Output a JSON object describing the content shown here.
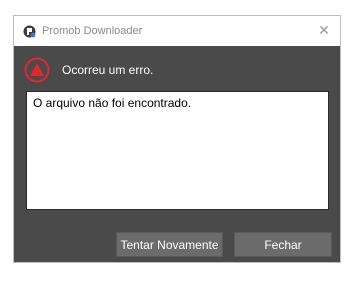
{
  "window": {
    "title": "Promob Downloader",
    "app_icon": "promob-logo-icon",
    "close_icon": "close-icon",
    "close_glyph": "✕"
  },
  "error": {
    "icon": "error-warning-icon",
    "heading": "Ocorreu um erro.",
    "message": "O arquivo não foi encontrado."
  },
  "buttons": {
    "retry_label": "Tentar Novamente",
    "close_label": "Fechar"
  },
  "colors": {
    "dialog_bg": "#4a4a4a",
    "button_bg": "#6b6b6b",
    "error_red": "#e0282e"
  }
}
